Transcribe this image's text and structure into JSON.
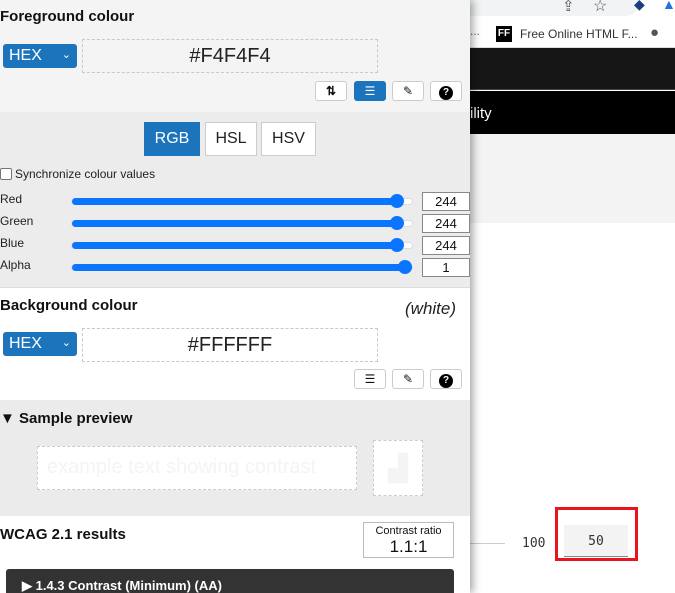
{
  "browser": {
    "bookmark_label": "Free Online HTML F...",
    "bookmark_icon": "FF",
    "page_nav_partial": "ility",
    "left_number": "100",
    "highlighted_value": "50",
    "highlight_color": "#e8141e"
  },
  "foreground": {
    "title": "Foreground colour",
    "format": "HEX",
    "value": "#F4F4F4",
    "tools": [
      "swap-icon",
      "sliders-icon",
      "eyedropper-icon",
      "help-icon"
    ],
    "tabs": [
      "RGB",
      "HSL",
      "HSV"
    ],
    "active_tab": "RGB",
    "sync_label": "Synchronize colour values",
    "sync_checked": false,
    "channels": [
      {
        "label": "Red",
        "value": "244",
        "fraction": 0.957
      },
      {
        "label": "Green",
        "value": "244",
        "fraction": 0.957
      },
      {
        "label": "Blue",
        "value": "244",
        "fraction": 0.957
      },
      {
        "label": "Alpha",
        "value": "1",
        "fraction": 1
      }
    ]
  },
  "background": {
    "title": "Background colour",
    "name": "(white)",
    "format": "HEX",
    "value": "#FFFFFF"
  },
  "preview": {
    "title": "Sample preview",
    "sample_text": "example text showing contrast"
  },
  "results": {
    "title": "WCAG 2.1 results",
    "ratio_label": "Contrast ratio",
    "ratio_value": "1.1:1",
    "criterion": "1.4.3 Contrast (Minimum) (AA)"
  },
  "colors": {
    "accent": "#1c75bc",
    "slider": "#0a75ff",
    "foreground": "#F4F4F4",
    "background": "#FFFFFF"
  }
}
